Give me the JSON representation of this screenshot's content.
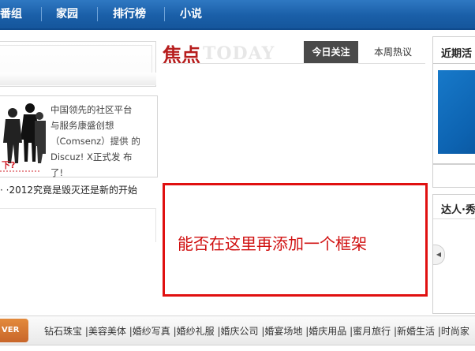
{
  "nav": {
    "items": [
      "番组",
      "家园",
      "排行榜",
      "小说"
    ]
  },
  "focus": {
    "title": "焦点",
    "subtitle": "TODAY",
    "tabs": [
      "今日关注",
      "本周热议"
    ]
  },
  "left": {
    "intro_lines": [
      "中国领先的社区平台",
      "与服务康盛创想",
      "（Comsenz）提供 的",
      "Discuz!  X正式发 布",
      "了!"
    ],
    "image_caption": "下?",
    "headline": "· ·2012究竟是毁灭还是新的开始"
  },
  "annotation": {
    "text": "能否在这里再添加一个框架"
  },
  "right": {
    "recent_title": "近期活",
    "expert_title": "达人·秀"
  },
  "bottom": {
    "badge": "VER",
    "links": [
      "钻石珠宝",
      "美容美体",
      "婚纱写真",
      "婚纱礼服",
      "婚庆公司",
      "婚宴场地",
      "婚庆用品",
      "蜜月旅行",
      "新婚生活",
      "时尚家"
    ]
  },
  "colors": {
    "nav_blue": "#1a5fa8",
    "focus_red": "#b71e1e",
    "annotation_red": "#e01010",
    "badge_orange": "#d2702f"
  }
}
